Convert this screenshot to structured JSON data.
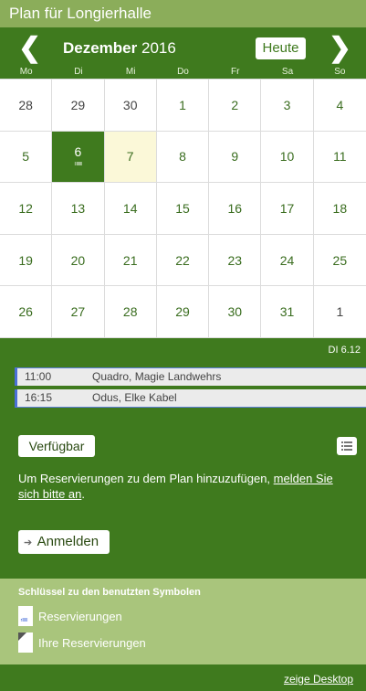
{
  "app": {
    "title": "Plan für Longierhalle"
  },
  "calendar": {
    "month": "Dezember",
    "year": "2016",
    "today_button": "Heute",
    "prev_icon": "chevron-left-icon",
    "next_icon": "chevron-right-icon",
    "weekdays": [
      "Mo",
      "Di",
      "Mi",
      "Do",
      "Fr",
      "Sa",
      "So"
    ],
    "weeks": [
      [
        "28",
        "29",
        "30",
        "1",
        "2",
        "3",
        "4"
      ],
      [
        "5",
        "6",
        "7",
        "8",
        "9",
        "10",
        "11"
      ],
      [
        "12",
        "13",
        "14",
        "15",
        "16",
        "17",
        "18"
      ],
      [
        "19",
        "20",
        "21",
        "22",
        "23",
        "24",
        "25"
      ],
      [
        "26",
        "27",
        "28",
        "29",
        "30",
        "31",
        "1"
      ]
    ],
    "reservation_mark": "≔"
  },
  "selected_day": {
    "label": "DI 6.12"
  },
  "events": [
    {
      "time": "11:00",
      "title": "Quadro, Magie Landwehrs"
    },
    {
      "time": "16:15",
      "title": "Odus, Elke Kabel"
    }
  ],
  "availability": {
    "button": "Verfügbar",
    "info_prefix": "Um Reservierungen zu dem Plan hinzuzufügen, ",
    "info_link": "melden Sie sich bitte an",
    "info_suffix": ".",
    "login_button": "Anmelden",
    "login_icon": "login-icon",
    "list_icon": "list-icon"
  },
  "key": {
    "title": "Schlüssel zu den benutzten Symbolen",
    "items": [
      {
        "label": "Reservierungen",
        "icon": "reservation-icon"
      },
      {
        "label": "Ihre Reservierungen",
        "icon": "own-reservation-icon"
      }
    ]
  },
  "footer": {
    "desktop_link": "zeige Desktop"
  },
  "colors": {
    "primary": "#3f7a1e",
    "light": "#a9c57c",
    "accent": "#4a6fd8",
    "today_bg": "#fbf8d8"
  }
}
